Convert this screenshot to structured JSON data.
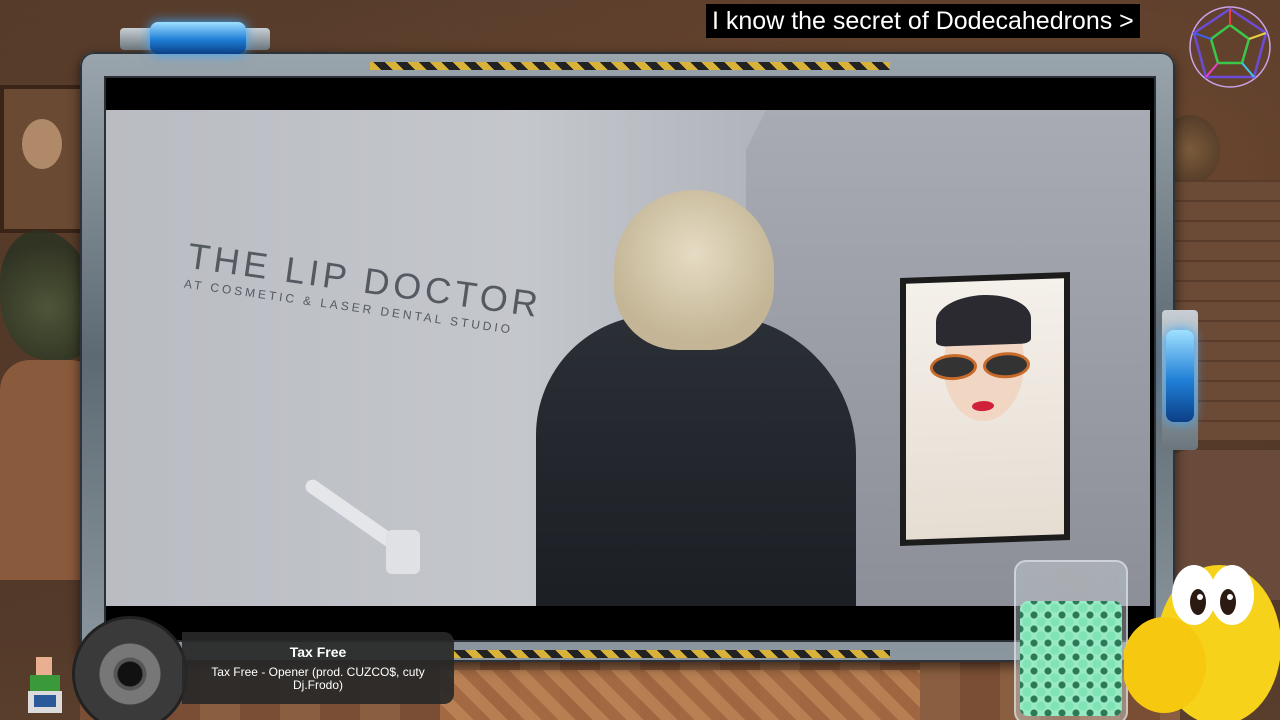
{
  "overlay": {
    "caption": "I know the secret of Dodecahedrons >"
  },
  "video": {
    "brand_title": "THE LIP DOCTOR",
    "brand_subtitle": "AT COSMETIC & LASER DENTAL STUDIO"
  },
  "now_playing": {
    "title": "Tax Free",
    "subtitle": "Tax Free - Opener (prod. CUZCO$, cuty Dj.Frodo)"
  },
  "colors": {
    "frame_accent": "#d9b23a",
    "capsule_glow": "#3aa7ff",
    "caption_bg": "#000000",
    "caption_text": "#ffffff"
  },
  "icons": {
    "dodecahedron": "dodecahedron-icon",
    "disc": "vinyl-disc-icon"
  }
}
